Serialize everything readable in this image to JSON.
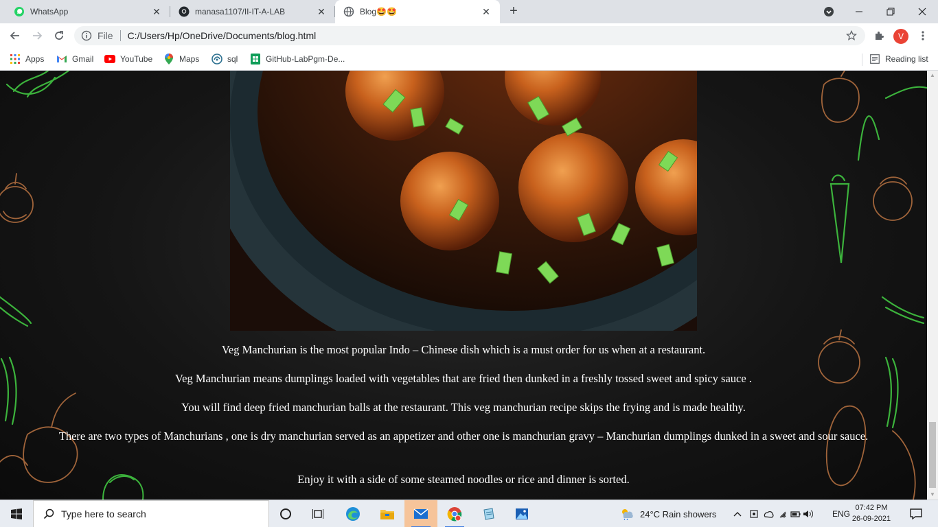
{
  "browser": {
    "tabs": [
      {
        "title": "WhatsApp",
        "icon": "whatsapp-icon",
        "active": false
      },
      {
        "title": "manasa1107/II-IT-A-LAB",
        "icon": "github-icon",
        "active": false
      },
      {
        "title": "Blog🤩🤩",
        "icon": "globe-icon",
        "active": true
      }
    ],
    "new_tab_label": "+",
    "address": {
      "scheme_label": "File",
      "url": "C:/Users/Hp/OneDrive/Documents/blog.html"
    },
    "profile_initial": "V",
    "bookmarks": [
      {
        "label": "Apps",
        "icon": "apps-grid-icon"
      },
      {
        "label": "Gmail",
        "icon": "gmail-icon"
      },
      {
        "label": "YouTube",
        "icon": "youtube-icon"
      },
      {
        "label": "Maps",
        "icon": "maps-icon"
      },
      {
        "label": "sql",
        "icon": "sql-icon"
      },
      {
        "label": "GitHub-LabPgm-De...",
        "icon": "sheets-icon"
      }
    ],
    "reading_list": "Reading list"
  },
  "page": {
    "paragraphs": [
      "Veg Manchurian is the most popular Indo – Chinese dish which is a must order for us when at a restaurant.",
      "Veg Manchurian means dumplings loaded with vegetables that are fried then dunked in a freshly tossed sweet and spicy sauce .",
      "You will find deep fried manchurian balls at the restaurant. This veg manchurian recipe skips the frying and is made healthy.",
      "There are two types of Manchurians , one is dry manchurian served as an appetizer and other one is manchurian gravy – Manchurian dumplings dunked in a sweet and sour sauce.",
      "Enjoy it with a side of some steamed noodles or rice and dinner is sorted."
    ]
  },
  "taskbar": {
    "search_placeholder": "Type here to search",
    "weather": "24°C  Rain showers",
    "language": "ENG",
    "time": "07:42 PM",
    "date": "26-09-2021"
  },
  "colors": {
    "tabstrip": "#dee1e6",
    "page_bg": "#151515",
    "text": "#ffffff",
    "taskbar": "#e8ecf2"
  }
}
